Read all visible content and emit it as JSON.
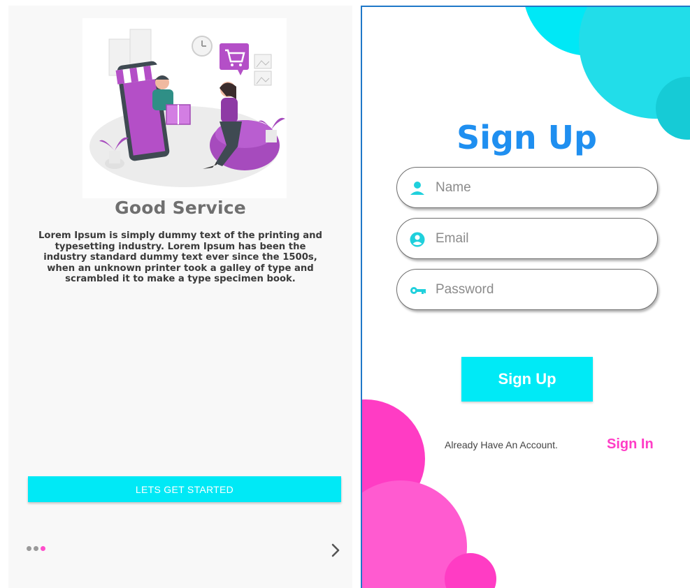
{
  "onboarding": {
    "title": "Good Service",
    "description": "Lorem Ipsum is simply dummy text of the printing and typesetting industry. Lorem Ipsum has been the industry standard dummy text ever since the 1500s, when an unknown printer took a galley of type and scrambled it to make a type specimen book.",
    "start_button": "LETS GET STARTED",
    "pager": {
      "total": 3,
      "active_index": 2
    },
    "next_icon": "chevron-right-icon"
  },
  "signup": {
    "title": "Sign Up",
    "fields": [
      {
        "icon": "person-icon",
        "placeholder": "Name",
        "value": ""
      },
      {
        "icon": "account-circle-icon",
        "placeholder": "Email",
        "value": ""
      },
      {
        "icon": "key-icon",
        "placeholder": "Password",
        "value": ""
      }
    ],
    "submit_button": "Sign Up",
    "account_prompt": "Already Have An Account.",
    "signin_link": "Sign In"
  },
  "colors": {
    "accent_cyan": "#00e9f6",
    "accent_pink": "#ff3dc6",
    "title_blue": "#1f8ff0",
    "illustration_purple": "#b44fc7"
  }
}
